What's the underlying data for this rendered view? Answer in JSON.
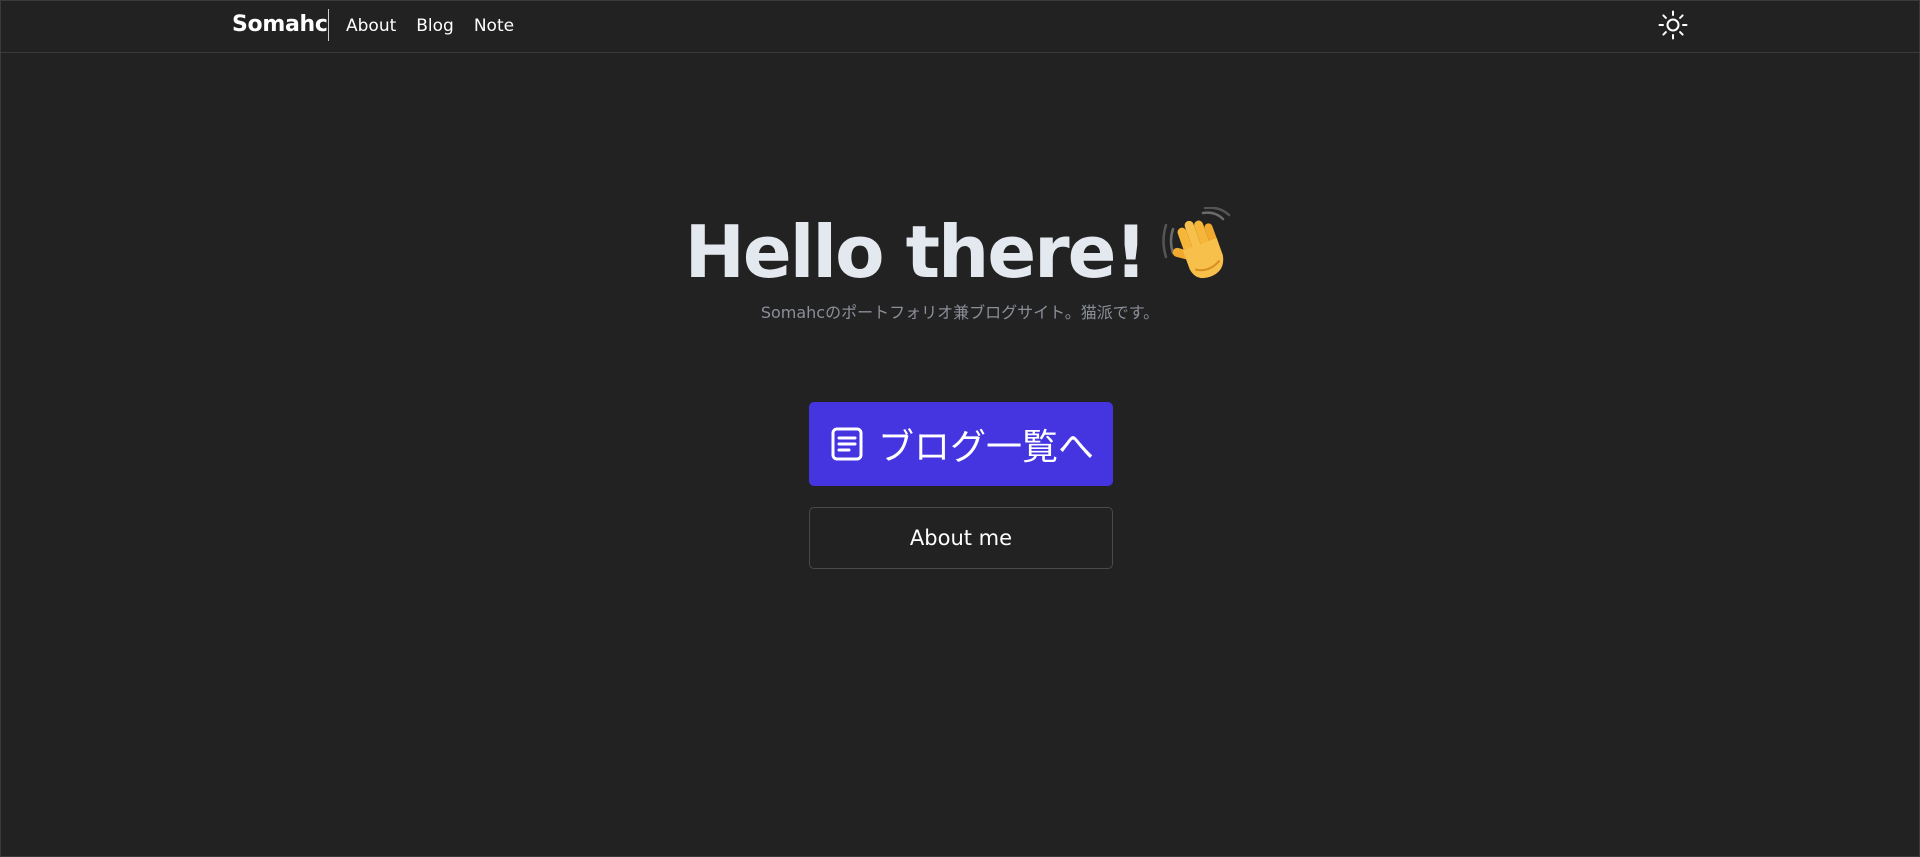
{
  "header": {
    "brand": "Somahc",
    "nav": [
      {
        "label": "About"
      },
      {
        "label": "Blog"
      },
      {
        "label": "Note"
      }
    ],
    "theme_toggle_icon": "sun-icon"
  },
  "hero": {
    "title": "Hello there!",
    "wave_icon": "waving-hand-icon",
    "subtitle": "Somahcのポートフォリオ兼ブログサイト。猫派です。"
  },
  "actions": {
    "blog_button": {
      "label": "ブログ一覧へ",
      "icon": "document-icon",
      "color": "#4535e0"
    },
    "about_button": {
      "label": "About me"
    }
  },
  "colors": {
    "background": "#222222",
    "accent": "#4535e0",
    "title": "#e4e8ef",
    "subtitle": "#8a8f98"
  }
}
